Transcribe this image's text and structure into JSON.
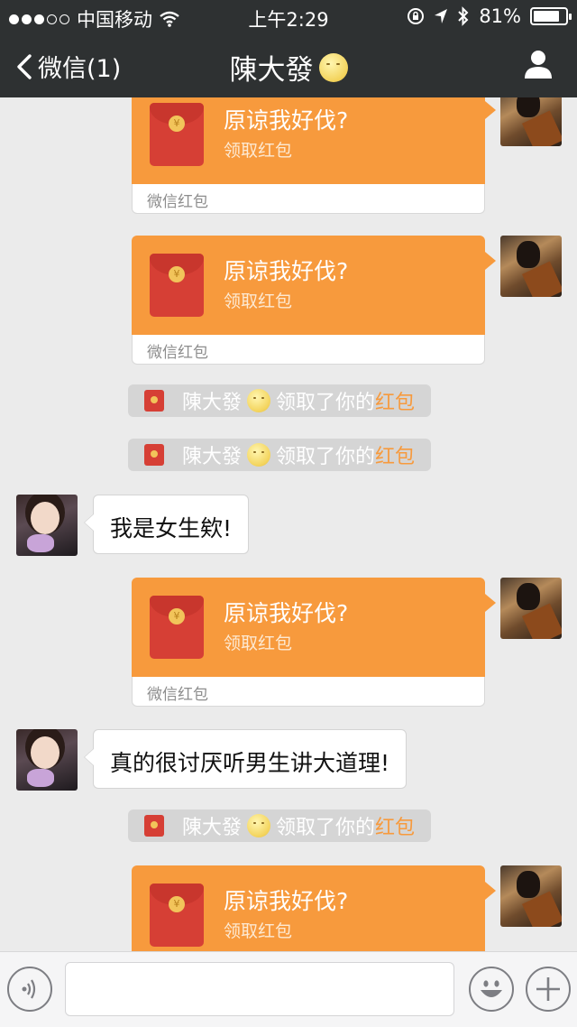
{
  "status_bar": {
    "carrier": "中国移动",
    "time": "上午2:29",
    "battery_percent": "81%",
    "battery_level": 0.81,
    "signal_strength": 3
  },
  "nav": {
    "back_label": "微信(1)",
    "title": "陳大發"
  },
  "red_packet": {
    "greeting": "原谅我好伐?",
    "action": "领取红包",
    "footer": "微信红包"
  },
  "notice": {
    "name": "陳大發",
    "text": "领取了你的",
    "highlight": "红包"
  },
  "messages": {
    "msg1": "我是女生欸!",
    "msg2": "真的很讨厌听男生讲大道理!"
  },
  "colors": {
    "nav_bg": "#2e3132",
    "packet_orange": "#f79a3d",
    "packet_red": "#d63f35",
    "chat_bg": "#ebebeb"
  }
}
